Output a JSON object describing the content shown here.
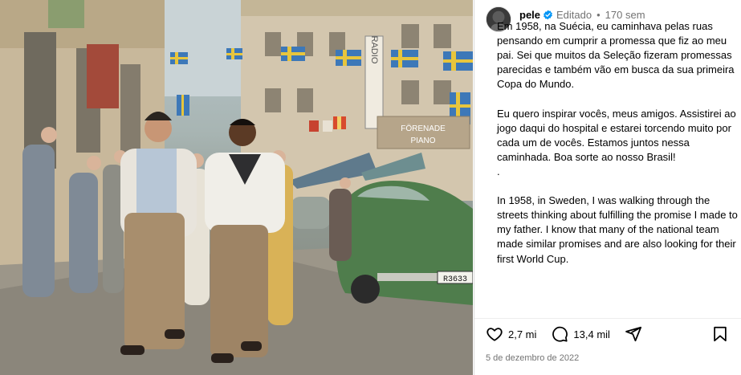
{
  "post": {
    "username": "pele",
    "edited_label": "Editado",
    "separator": "•",
    "age": "170 sem",
    "caption": "Em 1958, na Suécia, eu caminhava pelas ruas pensando em cumprir a promessa que fiz ao meu pai. Sei que muitos da Seleção fizeram promessas parecidas e também vão em busca da sua primeira Copa do Mundo.\n\nEu quero inspirar vocês, meus amigos. Assistirei ao jogo daqui do hospital e estarei torcendo muito por cada um de vocês. Estamos juntos nessa caminhada. Boa sorte ao nosso Brasil!\n.\n\nIn 1958, in Sweden, I was walking through the streets thinking about fulfilling the promise I made to my father. I know that many of the national team made similar promises and are also looking for their first World Cup.",
    "likes": "2,7 mi",
    "comments": "13,4 mil",
    "date": "5 de dezembro de 2022"
  },
  "photo": {
    "sign_radio": "RADIO",
    "sign_piano": "PIANO",
    "sign_forenade": "FÖRENADE",
    "plate": "R3633"
  },
  "icons": {
    "verified": "verified-badge-icon",
    "like": "heart-icon",
    "comment": "comment-icon",
    "share": "share-icon",
    "save": "bookmark-icon"
  },
  "colors": {
    "verified": "#0095f6",
    "muted": "#737373",
    "text": "#000000",
    "car": "#4f7d4c"
  }
}
